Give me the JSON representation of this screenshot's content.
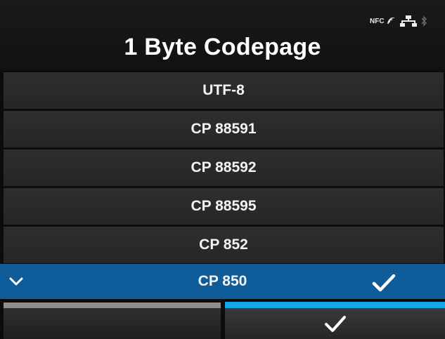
{
  "header": {
    "title": "1 Byte Codepage",
    "status": {
      "nfc_label": "NFC",
      "icons": [
        "nfc-icon",
        "lan-icon",
        "bluetooth-icon"
      ]
    }
  },
  "list": {
    "items": [
      {
        "label": "UTF-8",
        "selected": false
      },
      {
        "label": "CP 88591",
        "selected": false
      },
      {
        "label": "CP 88592",
        "selected": false
      },
      {
        "label": "CP 88595",
        "selected": false
      },
      {
        "label": "CP 852",
        "selected": false
      },
      {
        "label": "CP 850",
        "selected": true
      }
    ]
  },
  "footer": {
    "left_button_icon": "",
    "right_button_icon": "check-icon"
  },
  "colors": {
    "selected_row": "#0e5d9a",
    "accent_bar": "#14a6e6",
    "inactive_bar": "#8f8f8f"
  }
}
